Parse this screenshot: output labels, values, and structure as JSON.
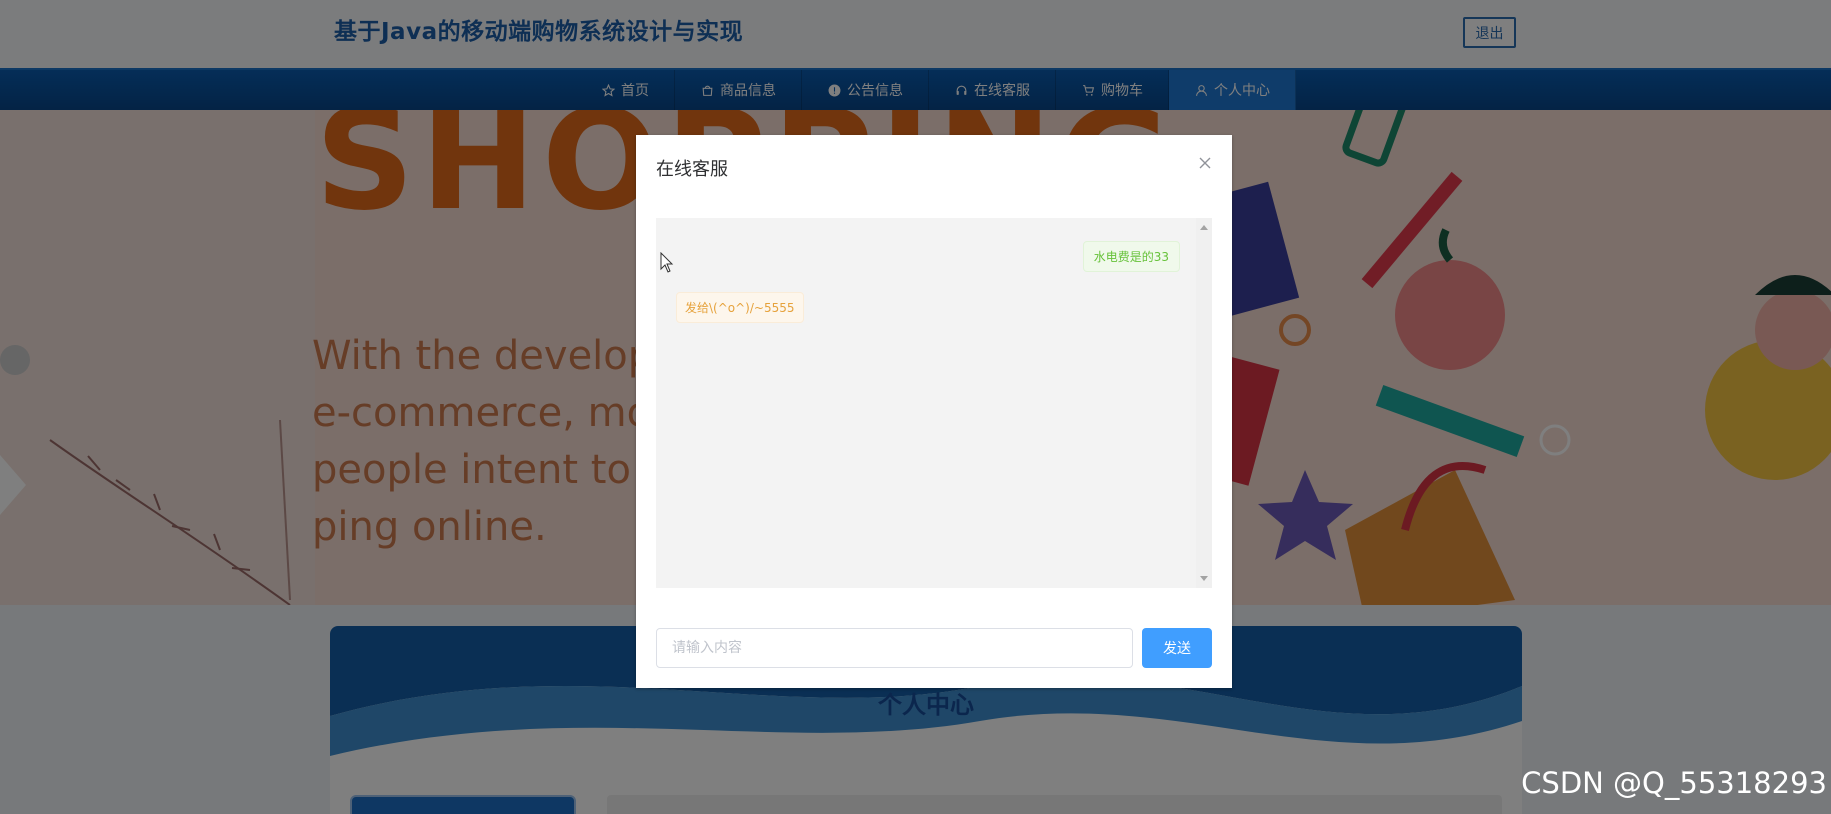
{
  "header": {
    "site_title": "基于Java的移动端购物系统设计与实现",
    "logout_label": "退出"
  },
  "nav": {
    "items": [
      {
        "label": "首页",
        "icon": "star-icon"
      },
      {
        "label": "商品信息",
        "icon": "bag-icon"
      },
      {
        "label": "公告信息",
        "icon": "info-icon"
      },
      {
        "label": "在线客服",
        "icon": "headset-icon"
      },
      {
        "label": "购物车",
        "icon": "cart-icon"
      },
      {
        "label": "个人中心",
        "icon": "user-icon"
      }
    ],
    "active_index": 5
  },
  "banner": {
    "big_word": "SHOPPING",
    "lines": [
      "With the develop",
      "e-commerce, more",
      "people intent to",
      "ping online."
    ]
  },
  "section": {
    "title": "个人中心"
  },
  "dialog": {
    "title": "在线客服",
    "messages": [
      {
        "side": "right",
        "text": "水电费是的33"
      },
      {
        "side": "left",
        "text": "发给\\(^o^)/~5555"
      }
    ],
    "input_placeholder": "请输入内容",
    "send_label": "发送"
  },
  "watermark": "CSDN @Q_55318293",
  "colors": {
    "nav_bg": "#0a5cb0",
    "nav_active": "#1e78d4",
    "primary_button": "#409eff",
    "title_blue": "#1d5ea8",
    "user_bubble": "#67c23a",
    "service_bubble": "#e6a23c"
  }
}
